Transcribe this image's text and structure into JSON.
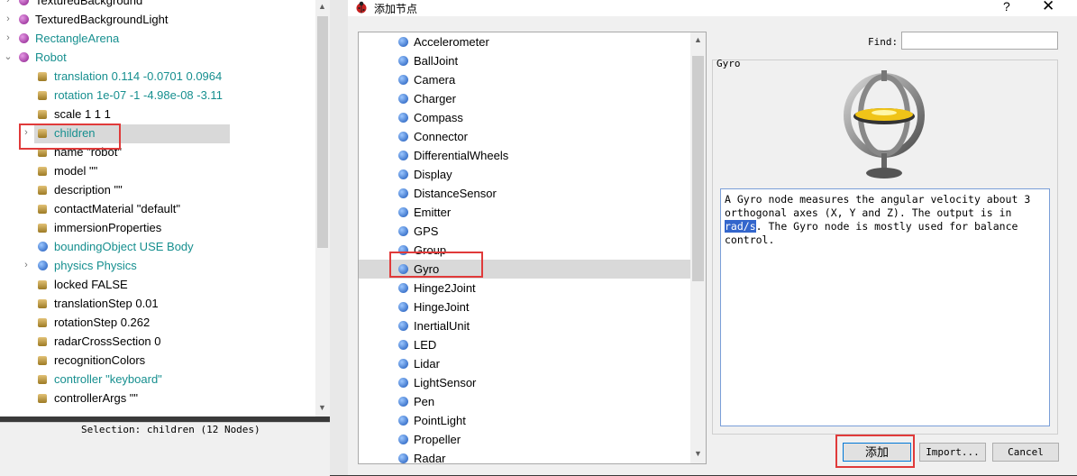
{
  "scene_tree": {
    "rows": [
      {
        "label": "TexturedBackground",
        "icon": "purple-node-icon",
        "expand": "›"
      },
      {
        "label": "TexturedBackgroundLight",
        "icon": "purple-node-icon",
        "expand": "›"
      },
      {
        "label": "RectangleArena",
        "icon": "purple-node-icon",
        "expand": "›"
      },
      {
        "label": "Robot",
        "icon": "purple-node-icon",
        "expand": "⌄"
      },
      {
        "label": "translation 0.114 -0.0701 0.0964",
        "icon": "field-icon"
      },
      {
        "label": "rotation 1e-07 -1 -4.98e-08 -3.11",
        "icon": "field-icon"
      },
      {
        "label": "scale 1 1 1",
        "icon": "field-icon"
      },
      {
        "label": "children",
        "icon": "field-icon",
        "expand": "›"
      },
      {
        "label": "name \"robot\"",
        "icon": "field-icon"
      },
      {
        "label": "model \"\"",
        "icon": "field-icon"
      },
      {
        "label": "description \"\"",
        "icon": "field-icon"
      },
      {
        "label": "contactMaterial \"default\"",
        "icon": "field-icon"
      },
      {
        "label": "immersionProperties",
        "icon": "field-icon"
      },
      {
        "label": "boundingObject USE Body",
        "icon": "blue-node-icon"
      },
      {
        "label": "physics Physics",
        "icon": "blue-node-icon",
        "expand": "›"
      },
      {
        "label": "locked FALSE",
        "icon": "field-icon"
      },
      {
        "label": "translationStep 0.01",
        "icon": "field-icon"
      },
      {
        "label": "rotationStep 0.262",
        "icon": "field-icon"
      },
      {
        "label": "radarCrossSection 0",
        "icon": "field-icon"
      },
      {
        "label": "recognitionColors",
        "icon": "field-icon"
      },
      {
        "label": "controller \"keyboard\"",
        "icon": "field-icon"
      },
      {
        "label": "controllerArgs \"\"",
        "icon": "field-icon"
      }
    ],
    "selection_status": "Selection: children (12 Nodes)"
  },
  "dialog": {
    "title": "添加节点",
    "help": "?",
    "close": "✕",
    "nodes": [
      "Accelerometer",
      "BallJoint",
      "Camera",
      "Charger",
      "Compass",
      "Connector",
      "DifferentialWheels",
      "Display",
      "DistanceSensor",
      "Emitter",
      "GPS",
      "Group",
      "Gyro",
      "Hinge2Joint",
      "HingeJoint",
      "InertialUnit",
      "LED",
      "Lidar",
      "LightSensor",
      "Pen",
      "PointLight",
      "Propeller",
      "Radar"
    ],
    "selected_node": "Gyro",
    "find_label": "Find:",
    "find_value": "",
    "info_title": "Gyro",
    "description_before": "A Gyro node measures the angular velocity about 3 orthogonal axes (X, Y and Z). The output is in ",
    "description_highlight": "rad/s",
    "description_after": ". The Gyro node is mostly used for balance control.",
    "add_label": "添加",
    "import_label": "Import...",
    "cancel_label": "Cancel"
  },
  "colors": {
    "highlight_box": "#e03a3a",
    "teal_text": "#168f8f",
    "selection": "#d9d9d9"
  }
}
